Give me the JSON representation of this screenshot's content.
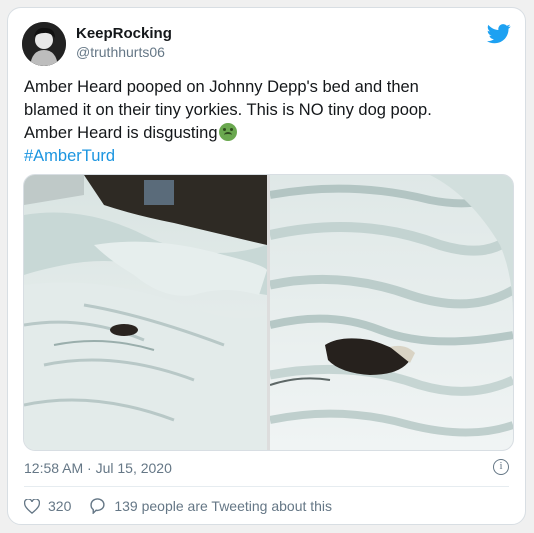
{
  "tweet": {
    "name": "KeepRocking",
    "handle": "@truthhurts06",
    "text_lines": [
      "Amber Heard pooped on Johnny Depp's bed and then",
      "blamed it on their tiny yorkies. This is NO tiny dog poop.",
      "Amber Heard is disgusting"
    ],
    "hashtag": "#AmberTurd",
    "timestamp": "12:58 AM · Jul 15, 2020",
    "like_count": "320",
    "reply_text": "139 people are Tweeting about this"
  },
  "icons": {
    "brand": "twitter-bird-icon",
    "emoji": "nauseated-face-icon",
    "info": "info-icon",
    "like": "heart-icon",
    "reply": "comment-icon"
  },
  "colors": {
    "brand_blue": "#1da1f2",
    "hashtag": "#1b95e0",
    "muted": "#657786",
    "text": "#14171a"
  }
}
